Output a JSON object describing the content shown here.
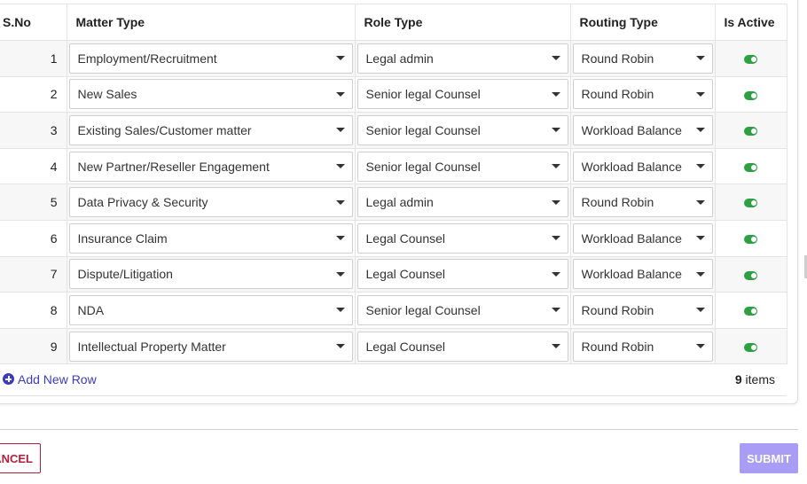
{
  "table": {
    "headers": {
      "sno": "S.No",
      "matter": "Matter Type",
      "role": "Role Type",
      "routing": "Routing Type",
      "active": "Is Active"
    },
    "rows": [
      {
        "sno": "1",
        "matter": "Employment/Recruitment",
        "role": "Legal admin",
        "routing": "Round Robin",
        "active": true
      },
      {
        "sno": "2",
        "matter": "New Sales",
        "role": "Senior legal Counsel",
        "routing": "Round Robin",
        "active": true
      },
      {
        "sno": "3",
        "matter": "Existing Sales/Customer matter",
        "role": "Senior legal Counsel",
        "routing": "Workload Balance",
        "active": true
      },
      {
        "sno": "4",
        "matter": "New Partner/Reseller Engagement",
        "role": "Senior legal Counsel",
        "routing": "Workload Balance",
        "active": true
      },
      {
        "sno": "5",
        "matter": "Data Privacy & Security",
        "role": "Legal admin",
        "routing": "Round Robin",
        "active": true
      },
      {
        "sno": "6",
        "matter": "Insurance Claim",
        "role": "Legal Counsel",
        "routing": "Workload Balance",
        "active": true
      },
      {
        "sno": "7",
        "matter": "Dispute/Litigation",
        "role": "Legal Counsel",
        "routing": "Workload Balance",
        "active": true
      },
      {
        "sno": "8",
        "matter": "NDA",
        "role": "Senior legal Counsel",
        "routing": "Round Robin",
        "active": true
      },
      {
        "sno": "9",
        "matter": "Intellectual Property Matter",
        "role": "Legal Counsel",
        "routing": "Round Robin",
        "active": true
      }
    ]
  },
  "footer": {
    "add_row_label": "Add New Row",
    "items_count": "9",
    "items_suffix": "items"
  },
  "actions": {
    "cancel_label": "ANCEL",
    "submit_label": "SUBMIT"
  },
  "colors": {
    "accent": "#3b3bbf",
    "toggle_on": "#2ea043",
    "cancel": "#b0203c",
    "submit_bg": "#a99cf5"
  },
  "icons": {
    "add": "plus-circle-icon",
    "dropdown": "caret-down-icon",
    "active": "toggle-on-icon"
  }
}
